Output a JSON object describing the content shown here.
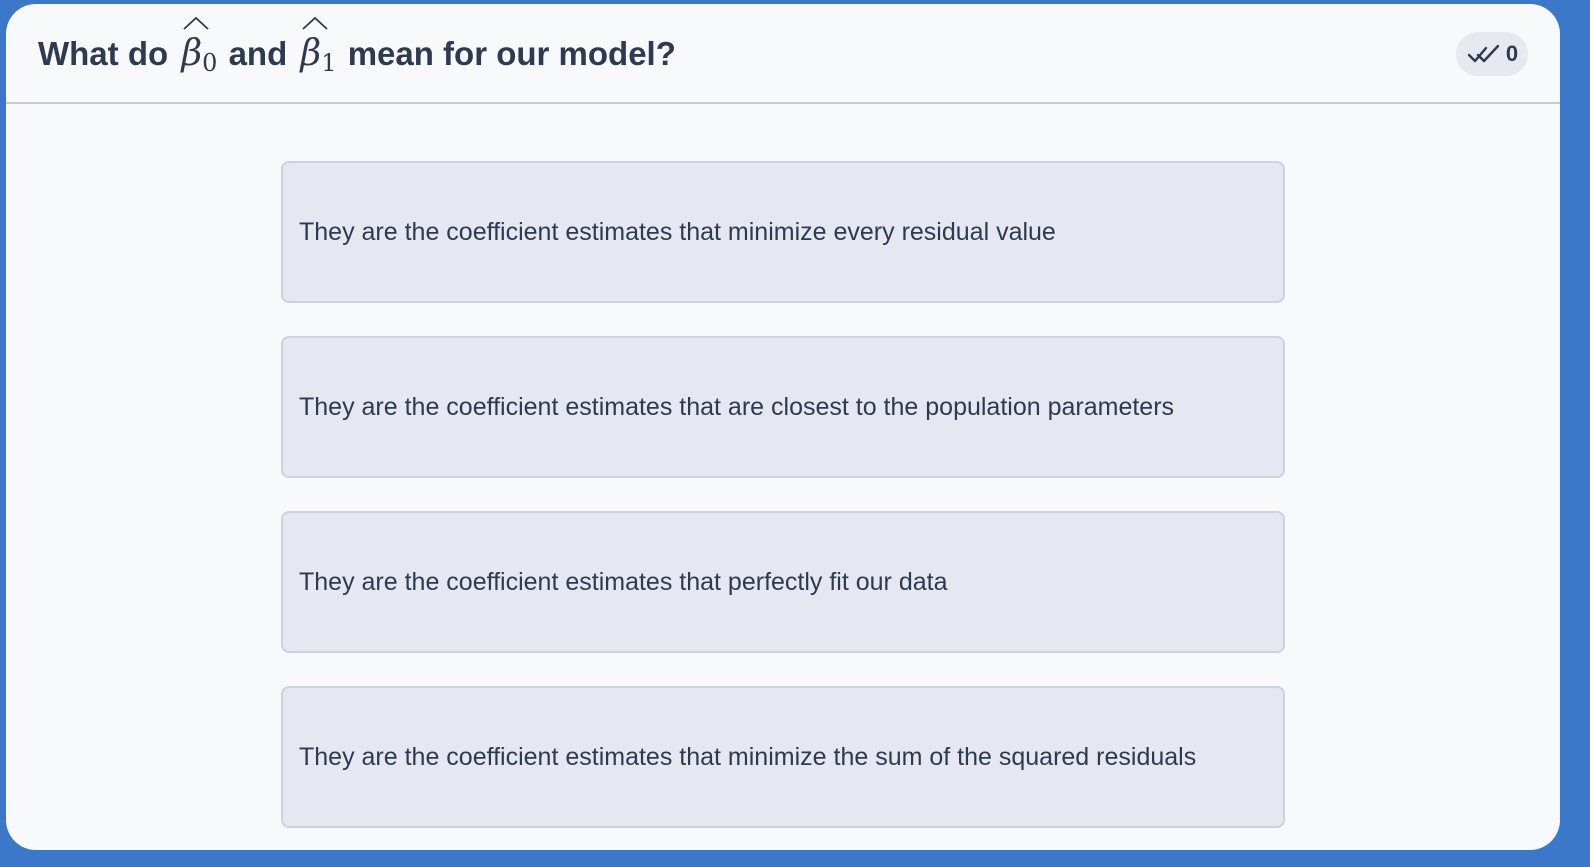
{
  "question": {
    "prefix": "What do",
    "beta_symbol": "β",
    "beta0_sub": "0",
    "conjunction": "and",
    "beta1_sub": "1",
    "suffix": "mean for our model?"
  },
  "counter": {
    "icon": "double-check-icon",
    "value": "0"
  },
  "options": [
    {
      "label": "They are the coefficient estimates that minimize every residual value"
    },
    {
      "label": "They are the coefficient estimates that are closest to the population parameters"
    },
    {
      "label": "They are the coefficient estimates that perfectly fit our data"
    },
    {
      "label": "They are the coefficient estimates that minimize the sum of the squared residuals"
    }
  ],
  "colors": {
    "border_accent": "#3b78c9",
    "background": "#f8f9fb",
    "option_background": "#e5e8f1",
    "text": "#2e3a4f"
  }
}
